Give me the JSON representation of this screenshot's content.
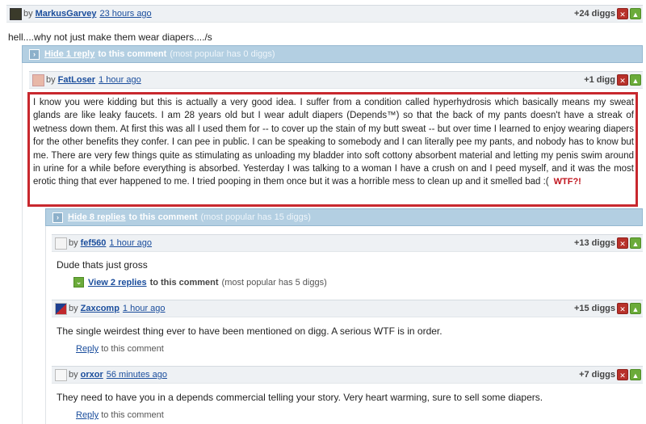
{
  "comments": {
    "c1": {
      "by_prefix": "by",
      "user": "MarkusGarvey",
      "time": "23 hours ago",
      "diggs": "+24 diggs",
      "text": "hell....why not just make them wear diapers..../s"
    },
    "reply_bar_1": {
      "link": "Hide 1 reply",
      "rest": "to this comment",
      "sub": "(most popular has 0 diggs)"
    },
    "c2": {
      "by_prefix": "by",
      "user": "FatLoser",
      "time": "1 hour ago",
      "diggs": "+1 digg",
      "text": "I know you were kidding but this is actually a very good idea. I suffer from a condition called hyperhydrosis which basically means my sweat glands are like leaky faucets. I am 28 years old but I wear adult diapers (Depends™) so that the back of my pants doesn't have a streak of wetness down them. At first this was all I used them for -- to cover up the stain of my butt sweat -- but over time I learned to enjoy wearing diapers for the other benefits they confer. I can pee in public. I can be speaking to somebody and I can literally pee my pants, and nobody has to know but me. There are very few things quite as stimulating as unloading my bladder into soft cottony absorbent material and letting my penis swim around in urine for a while before everything is absorbed. Yesterday I was talking to a woman I have a crush on and I peed myself, and it was the most erotic thing that ever happened to me. I tried pooping in them once but it was a horrible mess to clean up and it smelled bad :(",
      "annotation": "WTF?!"
    },
    "reply_bar_2": {
      "link": "Hide 8 replies",
      "rest": "to this comment",
      "sub": "(most popular has 15 diggs)"
    },
    "c3": {
      "by_prefix": "by",
      "user": "fef560",
      "time": "1 hour ago",
      "diggs": "+13 diggs",
      "text": "Dude thats just gross",
      "view_link": "View 2 replies",
      "view_rest": "to this comment",
      "view_sub": "(most popular has 5 diggs)"
    },
    "c4": {
      "by_prefix": "by",
      "user": "Zaxcomp",
      "time": "1 hour ago",
      "diggs": "+15 diggs",
      "text": "The single weirdest thing ever to have been mentioned on digg. A serious WTF is in order.",
      "reply_link": "Reply",
      "reply_rest": "to this comment"
    },
    "c5": {
      "by_prefix": "by",
      "user": "orxor",
      "time": "56 minutes ago",
      "diggs": "+7 diggs",
      "text": "They need to have you in a depends commercial telling your story. Very heart warming, sure to sell some diapers.",
      "reply_link": "Reply",
      "reply_rest": "to this comment"
    }
  },
  "icons": {
    "bury": "bury-icon",
    "digg": "digg-thumb-icon",
    "expand": "expand-arrow-icon"
  },
  "colors": {
    "link": "#1a4d9c",
    "highlight_border": "#c8282e",
    "reply_bar": "#b3cfe2",
    "bury": "#b8312a",
    "digg": "#6bab3a"
  }
}
